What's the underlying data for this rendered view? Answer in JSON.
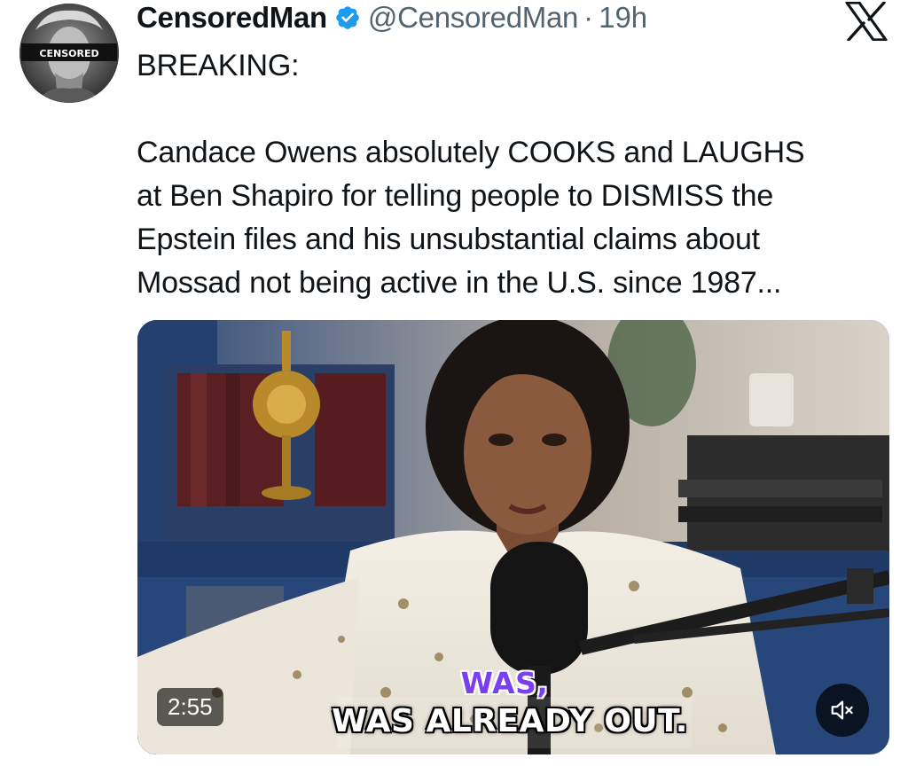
{
  "author": {
    "display_name": "CensoredMan",
    "handle": "@CensoredMan",
    "separator": "·",
    "time": "19h",
    "avatar_badge": "CENSORED",
    "verified": true
  },
  "tweet": {
    "lines_head": [
      "BREAKING:"
    ],
    "lines_body": [
      "Candace Owens absolutely COOKS and LAUGHS",
      "at Ben Shapiro for telling people to DISMISS the",
      "Epstein files and his unsubstantial claims about",
      "Mossad not being active in the U.S. since 1987..."
    ]
  },
  "media": {
    "duration": "2:55",
    "caption_top": "WAS,",
    "caption_main": "WAS ALREADY OUT.",
    "mute_icon": "speaker-muted-icon"
  },
  "icons": {
    "platform_logo": "x-logo-icon",
    "verified": "verified-badge-icon"
  },
  "colors": {
    "text": "#0f1419",
    "secondary": "#536471",
    "verified_blue": "#1d9bf0",
    "caption_purple": "#7b3ff2"
  }
}
